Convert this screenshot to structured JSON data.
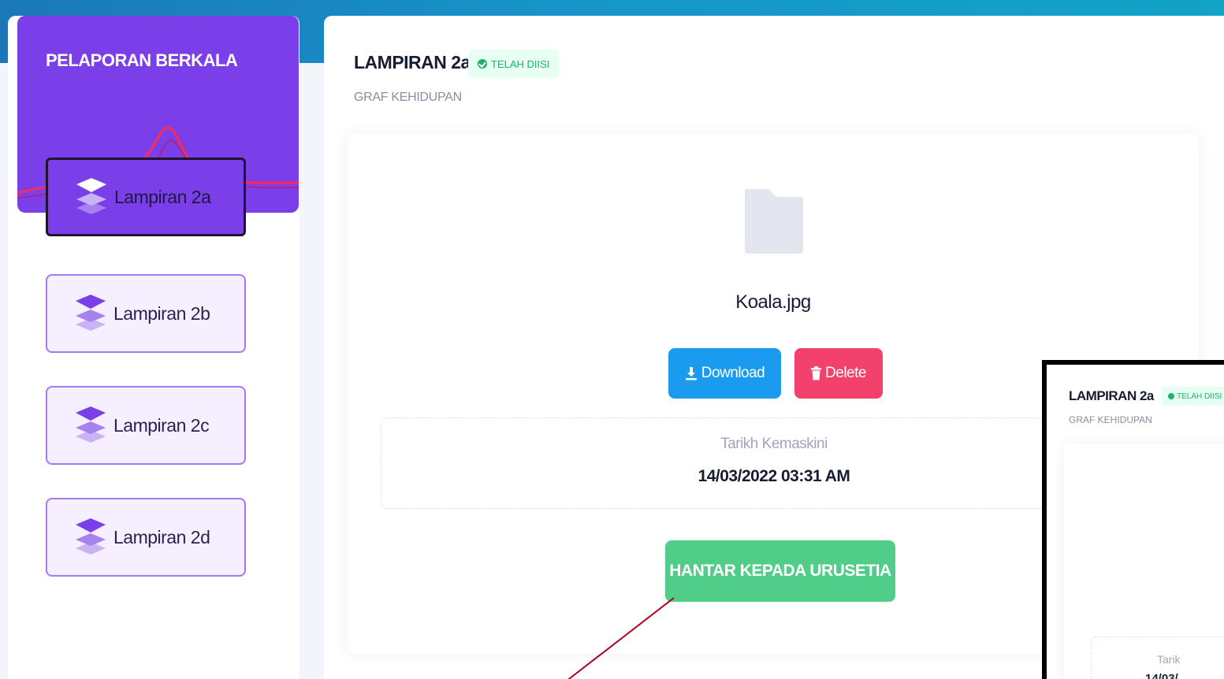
{
  "sidebar": {
    "title": "PELAPORAN BERKALA",
    "items": [
      {
        "label": "Lampiran 2a",
        "active": true,
        "icon": "layers-icon"
      },
      {
        "label": "Lampiran 2b",
        "active": false,
        "icon": "layers-icon"
      },
      {
        "label": "Lampiran 2c",
        "active": false,
        "icon": "layers-icon"
      },
      {
        "label": "Lampiran 2d",
        "active": false,
        "icon": "layers-icon"
      }
    ]
  },
  "main": {
    "title": "LAMPIRAN 2a",
    "status_badge": "TELAH DIISI",
    "subtitle": "GRAF KEHIDUPAN",
    "file": {
      "icon": "folder-icon",
      "name": "Koala.jpg",
      "download_label": "Download",
      "delete_label": "Delete"
    },
    "updated": {
      "label": "Tarikh Kemaskini",
      "value": "14/03/2022 03:31 AM"
    },
    "submit_label": "HANTAR KEPADA URUSETIA"
  },
  "inset": {
    "title": "LAMPIRAN 2a",
    "status_badge": "TELAH DIISI",
    "subtitle": "GRAF KEHIDUPAN",
    "date_label_partial": "Tarik",
    "date_value_partial": "14/03/"
  },
  "colors": {
    "sidebar_accent": "#7a3fe8",
    "download": "#1a9bef",
    "delete": "#f1416c",
    "submit": "#50cd89",
    "status": "#1bb36b",
    "annotation_arrow": "#b00020"
  }
}
